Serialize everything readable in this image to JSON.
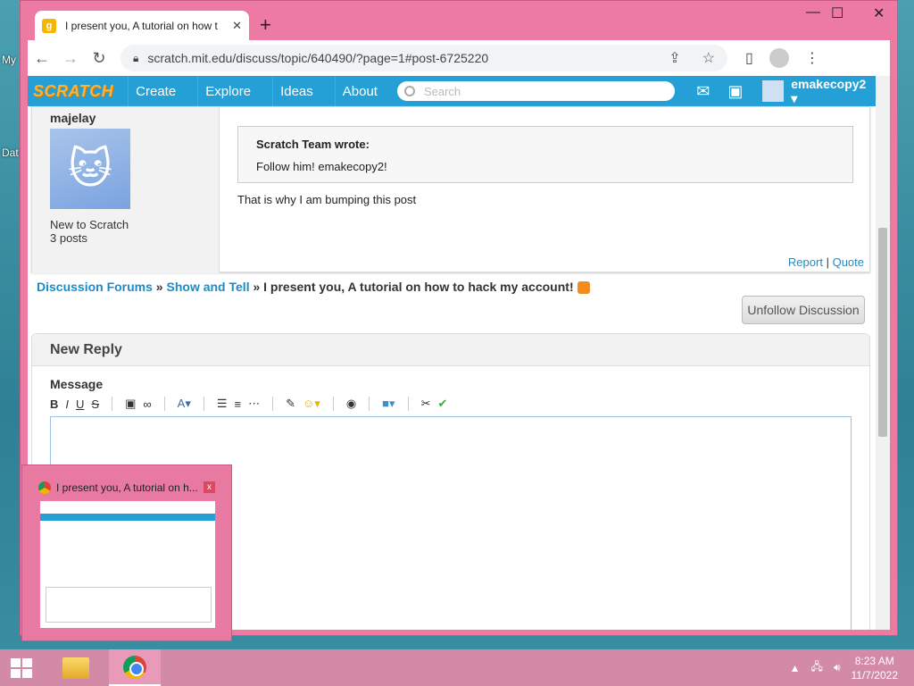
{
  "desktop": {
    "icon_labels": [
      "My",
      "Dat"
    ]
  },
  "browser": {
    "tab_title": "I present you, A tutorial on how t",
    "tab_favicon_letter": "g",
    "new_tab": "+",
    "url": "scratch.mit.edu/discuss/topic/640490/?page=1#post-6725220",
    "minimize": "—",
    "maximize": "☐",
    "close": "✕"
  },
  "scratch_nav": {
    "logo": "SCRATCH",
    "links": [
      "Create",
      "Explore",
      "Ideas",
      "About"
    ],
    "search_placeholder": "Search",
    "username": "emakecopy2 ▾"
  },
  "post": {
    "author": "majelay",
    "author_rank": "New to Scratch",
    "author_posts": "3 posts",
    "quote_author": "Scratch Team wrote:",
    "quote_text": "Follow him! emakecopy2!",
    "body": "That is why I am bumping this post",
    "report": "Report",
    "separator": "|",
    "quote_link": "Quote"
  },
  "breadcrumb": {
    "forums": "Discussion Forums",
    "sep1": " » ",
    "category": "Show and Tell",
    "sep2": " » ",
    "topic": "I present you, A tutorial on how to hack my account!"
  },
  "unfollow_label": "Unfollow Discussion",
  "reply": {
    "heading": "New Reply",
    "message_label": "Message",
    "toolbar": {
      "bold": "B",
      "italic": "I",
      "underline": "U",
      "strike": "S"
    }
  },
  "thumbnail": {
    "title": "I present you, A tutorial on h...",
    "close": "x"
  },
  "taskbar": {
    "time": "8:23 AM",
    "date": "11/7/2022"
  }
}
